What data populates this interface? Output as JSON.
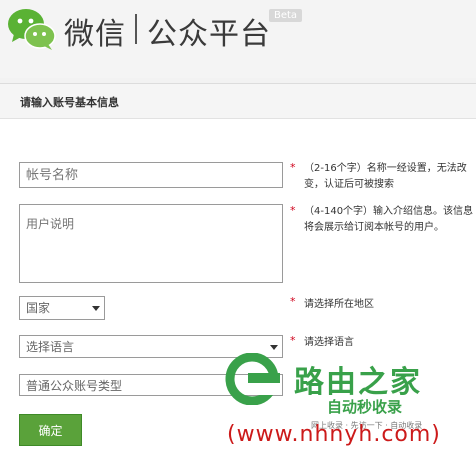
{
  "header": {
    "brand": "微信",
    "platform": "公众平台",
    "badge": "Beta"
  },
  "panel": {
    "title": "请输入账号基本信息"
  },
  "form": {
    "name_placeholder": "帐号名称",
    "name_hint": "（2-16个字）名称一经设置，无法改变，认证后可被搜索",
    "desc_placeholder": "用户说明",
    "desc_hint": "（4-140个字）输入介绍信息。该信息将会展示给订阅本帐号的用户。",
    "country_value": "国家",
    "country_hint": "请选择所在地区",
    "language_value": "选择语言",
    "language_hint": "请选择语言",
    "type_value": "普通公众账号类型",
    "required_mark": "*",
    "confirm_label": "确定"
  },
  "watermark": {
    "title": "路由之家",
    "subtitle": "自动秒收录",
    "slogan": "网上收录 · 先访一下 · 自动收录",
    "url": "(www.nhnyh.com)"
  },
  "colors": {
    "brand_green": "#5aa23a",
    "required_red": "#d0021b",
    "watermark_green": "#39a14a",
    "watermark_red": "#cc1a1a"
  }
}
